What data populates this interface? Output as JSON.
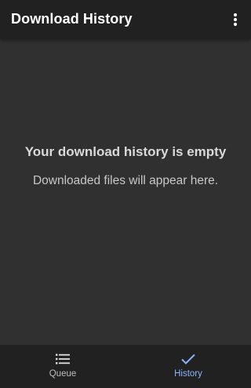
{
  "app_bar": {
    "title": "Download History",
    "overflow_icon": "more-vert-icon"
  },
  "empty_state": {
    "title": "Your download history is empty",
    "subtitle": "Downloaded files will appear here."
  },
  "bottom_nav": {
    "items": [
      {
        "label": "Queue",
        "icon": "list-icon",
        "active": false
      },
      {
        "label": "History",
        "icon": "check-icon",
        "active": true
      }
    ],
    "active_color": "#8ab4f8",
    "inactive_color": "#bdbdbd"
  },
  "colors": {
    "app_bar_bg": "#212121",
    "body_bg": "#303030"
  }
}
